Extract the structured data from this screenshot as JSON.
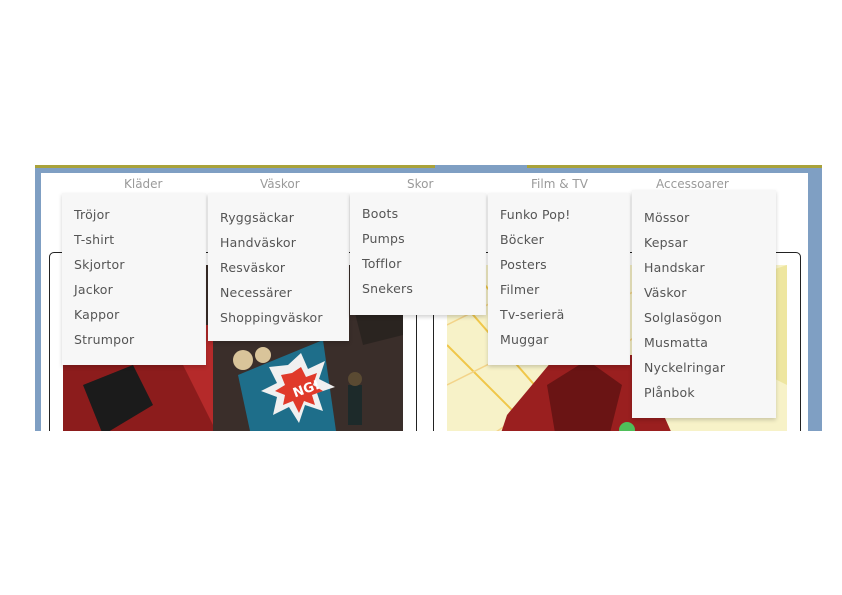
{
  "nav": {
    "items": [
      "Kläder",
      "Väskor",
      "Skor",
      "Film & TV",
      "Accessoarer"
    ]
  },
  "menus": {
    "klader": [
      "Tröjor",
      "T-shirt",
      "Skjortor",
      "Jackor",
      "Kappor",
      "Strumpor"
    ],
    "vaskor": [
      "Ryggsäckar",
      "Handväskor",
      "Resväskor",
      "Necessärer",
      "Shoppingväskor"
    ],
    "skor": [
      "Boots",
      "Pumps",
      "Tofflor",
      "Snekers"
    ],
    "film_tv": [
      "Funko Pop!",
      "Böcker",
      "Posters",
      "Filmer",
      "Tv-serierä",
      "Muggar"
    ],
    "accessoarer": [
      "Mössor",
      "Kepsar",
      "Handskar",
      "Väskor",
      "Solglasögon",
      "Musmatta",
      "Nyckelringar",
      "Plånbok"
    ]
  },
  "colors": {
    "frame": "#7f9fc3",
    "accent_bar": "#a9a23a",
    "nav_text": "#9a9a9a",
    "dropdown_bg": "#f7f7f7",
    "dropdown_text": "#555555"
  }
}
